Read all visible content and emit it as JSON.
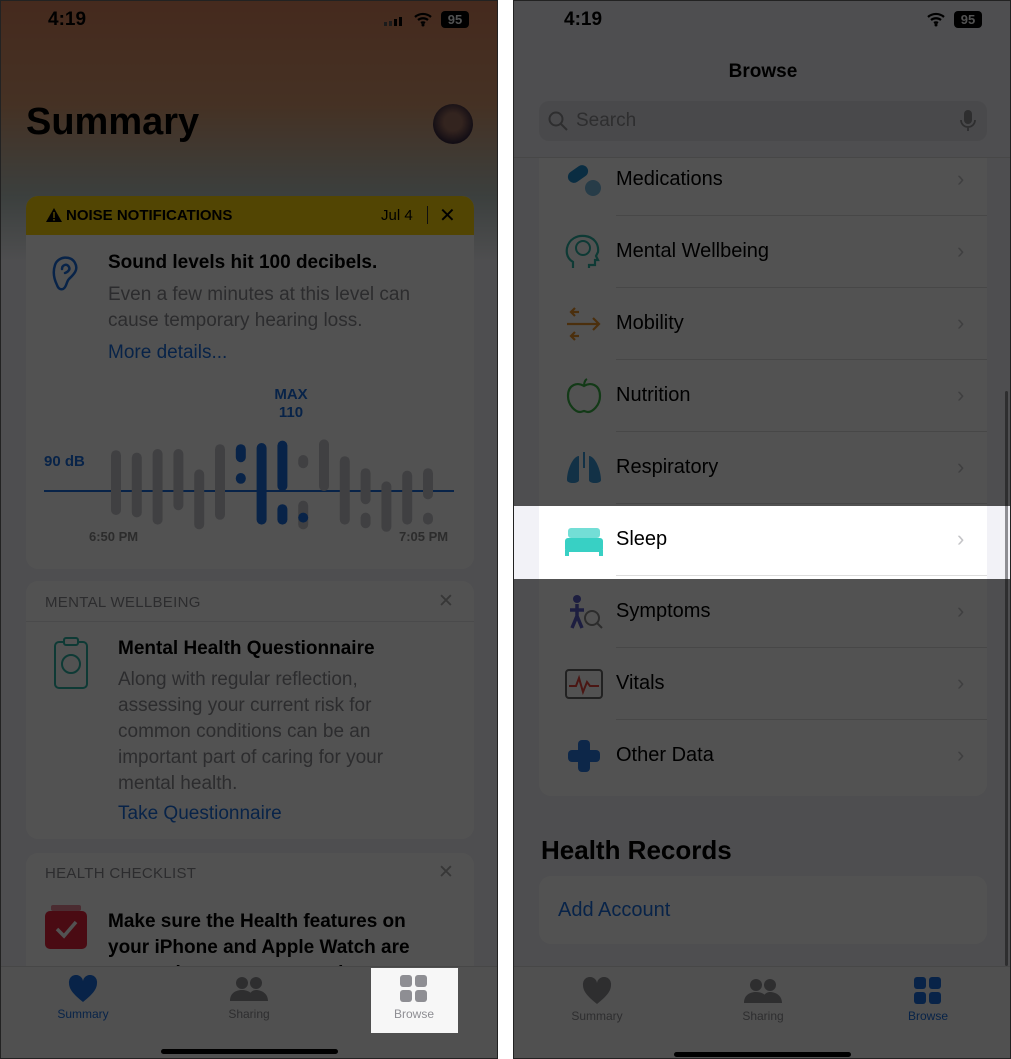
{
  "left": {
    "status": {
      "time": "4:19",
      "battery": "95"
    },
    "title": "Summary",
    "noise_card": {
      "header": "NOISE NOTIFICATIONS",
      "date": "Jul 4",
      "title": "Sound levels hit 100 decibels.",
      "body_line1": "Even a few minutes at this level can",
      "body_line2": "cause temporary hearing loss.",
      "link": "More details...",
      "colors": {
        "header": "#ffd60a",
        "accent": "#1a6fe0"
      }
    },
    "mental_card": {
      "header": "MENTAL WELLBEING",
      "title": "Mental Health Questionnaire",
      "body": [
        "Along with regular reflection,",
        "assessing your current risk for",
        "common conditions can be an",
        "important part of caring for your",
        "mental health."
      ],
      "link": "Take Questionnaire"
    },
    "checklist_card": {
      "header": "HEALTH CHECKLIST",
      "body": [
        "Make sure the Health features on",
        "your iPhone and Apple Watch are",
        "set up the way you want them."
      ]
    },
    "tabs": [
      {
        "label": "Summary",
        "icon": "heart-icon",
        "active": true
      },
      {
        "label": "Sharing",
        "icon": "people-icon"
      },
      {
        "label": "Browse",
        "icon": "grid-icon",
        "highlighted": true
      }
    ]
  },
  "chart_data": {
    "type": "bar",
    "threshold_label": "90 dB",
    "threshold": 90,
    "max_label": "MAX",
    "max_value": "110",
    "x_start_label": "6:50 PM",
    "x_end_label": "7:05 PM",
    "bars": [
      {
        "segments": [
          [
            80,
            107,
            "gray"
          ]
        ]
      },
      {
        "segments": [
          [
            79,
            106,
            "gray"
          ]
        ]
      },
      {
        "segments": [
          [
            76,
            107.5,
            "gray"
          ]
        ]
      },
      {
        "segments": [
          [
            82,
            107.5,
            "gray"
          ]
        ]
      },
      {
        "segments": [
          [
            74,
            99,
            "gray"
          ]
        ]
      },
      {
        "segments": [
          [
            78,
            109.5,
            "gray"
          ]
        ]
      },
      {
        "segments": [
          [
            102,
            109.5,
            "blue"
          ],
          [
            93,
            97.5,
            "blue"
          ]
        ]
      },
      {
        "segments": [
          [
            76,
            110,
            "blue"
          ]
        ]
      },
      {
        "segments": [
          [
            90,
            111,
            "blue"
          ],
          [
            76,
            84.5,
            "blue"
          ]
        ]
      },
      {
        "segments": [
          [
            99.5,
            105,
            "gray"
          ],
          [
            74,
            86,
            "gray"
          ],
          [
            80,
            81,
            "blue"
          ]
        ]
      },
      {
        "segments": [
          [
            90,
            111.5,
            "gray"
          ]
        ]
      },
      {
        "segments": [
          [
            76,
            104.5,
            "gray"
          ]
        ]
      },
      {
        "segments": [
          [
            84.5,
            99.5,
            "gray"
          ],
          [
            74.5,
            81,
            "gray"
          ]
        ]
      },
      {
        "segments": [
          [
            73,
            94,
            "gray"
          ]
        ]
      },
      {
        "segments": [
          [
            76,
            98.5,
            "gray"
          ]
        ]
      },
      {
        "segments": [
          [
            86.5,
            99.5,
            "gray"
          ],
          [
            76,
            81,
            "gray"
          ]
        ]
      }
    ]
  },
  "right": {
    "status": {
      "time": "4:19",
      "battery": "95"
    },
    "nav_title": "Browse",
    "search_placeholder": "Search",
    "categories": [
      {
        "label": "Medications",
        "icon": "pills-icon",
        "color": "#1f8ccc"
      },
      {
        "label": "Mental Wellbeing",
        "icon": "brain-head-icon",
        "color": "#2db3a6"
      },
      {
        "label": "Mobility",
        "icon": "arrows-icon",
        "color": "#e8922a"
      },
      {
        "label": "Nutrition",
        "icon": "apple-icon",
        "color": "#3cb34a"
      },
      {
        "label": "Respiratory",
        "icon": "lungs-icon",
        "color": "#3a9ad9"
      },
      {
        "label": "Sleep",
        "icon": "bed-icon",
        "color": "#38d0c4",
        "highlighted": true
      },
      {
        "label": "Symptoms",
        "icon": "symptoms-icon",
        "color": "#5b5fc7"
      },
      {
        "label": "Vitals",
        "icon": "vitals-icon",
        "color": "#e5443b"
      },
      {
        "label": "Other Data",
        "icon": "plus-icon",
        "color": "#2a7be4"
      }
    ],
    "records_title": "Health Records",
    "add_account": "Add Account",
    "tabs": [
      {
        "label": "Summary",
        "icon": "heart-icon"
      },
      {
        "label": "Sharing",
        "icon": "people-icon"
      },
      {
        "label": "Browse",
        "icon": "grid-icon",
        "active": true
      }
    ]
  }
}
